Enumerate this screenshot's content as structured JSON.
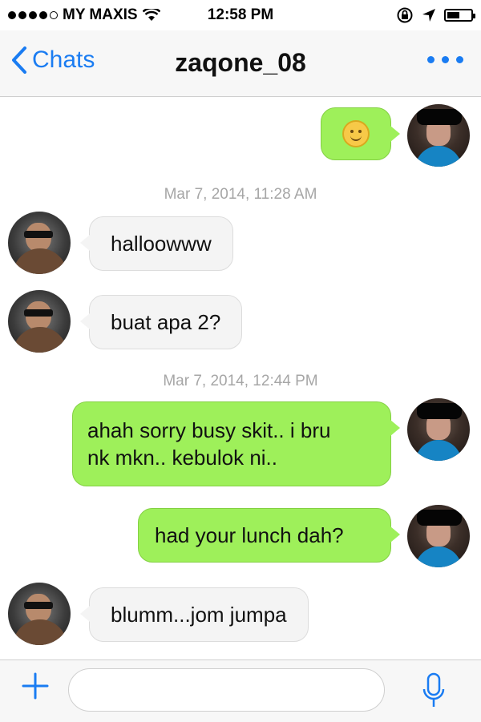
{
  "status_bar": {
    "carrier": "MY MAXIS",
    "time": "12:58 PM",
    "signal_bars": 4,
    "battery_level": 0.55
  },
  "nav": {
    "back_label": "Chats",
    "title": "zaqone_08"
  },
  "input": {
    "placeholder": ""
  },
  "messages": [
    {
      "direction": "outgoing",
      "type": "emoji",
      "icon": "smiley-emoji"
    },
    {
      "direction": "timestamp",
      "text": "Mar 7, 2014, 11:28 AM"
    },
    {
      "direction": "incoming",
      "text": "halloowww"
    },
    {
      "direction": "incoming",
      "text": "buat apa 2?"
    },
    {
      "direction": "timestamp",
      "text": "Mar 7, 2014, 12:44 PM"
    },
    {
      "direction": "outgoing",
      "lines": [
        "ahah sorry busy skit.. i bru",
        "nk mkn.. kebulok ni.."
      ]
    },
    {
      "direction": "outgoing",
      "text": "had your lunch dah?"
    },
    {
      "direction": "incoming",
      "text": "blumm...jom jumpa"
    }
  ],
  "colors": {
    "accent": "#1a7cf2",
    "outgoing_bubble": "#9ef05a",
    "incoming_bubble": "#f4f4f4",
    "timestamp": "#a6a6a6"
  }
}
